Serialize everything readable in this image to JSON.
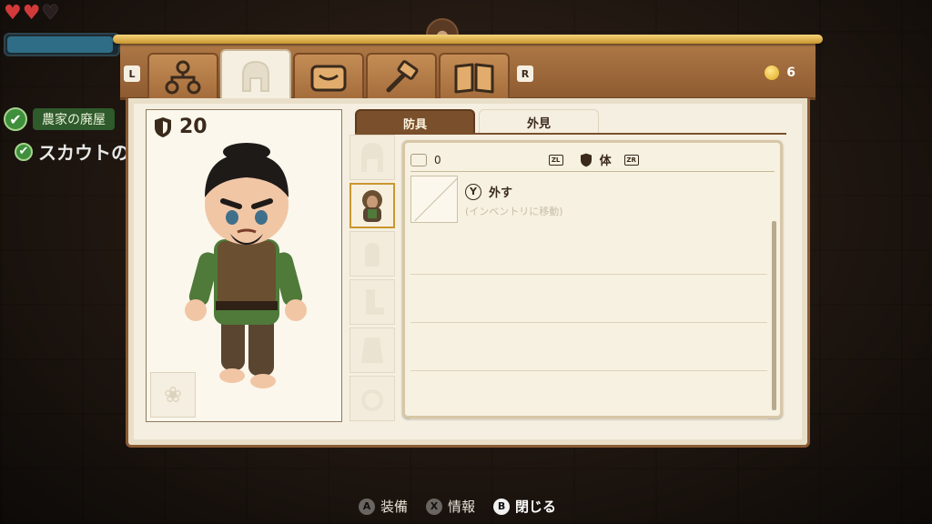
{
  "hud": {
    "hearts": [
      "full",
      "full",
      "empty"
    ],
    "stamina_fraction": 0.97,
    "quests": [
      {
        "label": "農家の廃屋",
        "done": true
      },
      {
        "label": "スカウトの",
        "done": true
      }
    ]
  },
  "topbar": {
    "left_button": "L",
    "right_button": "R",
    "tabs": [
      {
        "icon": "skills-tree-icon",
        "active": false
      },
      {
        "icon": "helmet-icon",
        "active": true
      },
      {
        "icon": "bag-icon",
        "active": false
      },
      {
        "icon": "crafting-hammer-icon",
        "active": false
      },
      {
        "icon": "map-book-icon",
        "active": false
      }
    ],
    "coins": "6"
  },
  "character": {
    "defense": "20"
  },
  "subtabs": {
    "armor": "防具",
    "appearance": "外見"
  },
  "list": {
    "count": "0",
    "zl": "ZL",
    "zr": "ZR",
    "category": "体",
    "item": {
      "button": "Y",
      "action": "外す",
      "subtext": "(インベントリに移動)"
    }
  },
  "hints": [
    {
      "button": "A",
      "label": "装備"
    },
    {
      "button": "X",
      "label": "情報"
    },
    {
      "button": "B",
      "label": "閉じる"
    }
  ],
  "colors": {
    "panel_wood": "#a26b3a",
    "parchment": "#f5efe1",
    "gold": "#c9962f"
  }
}
